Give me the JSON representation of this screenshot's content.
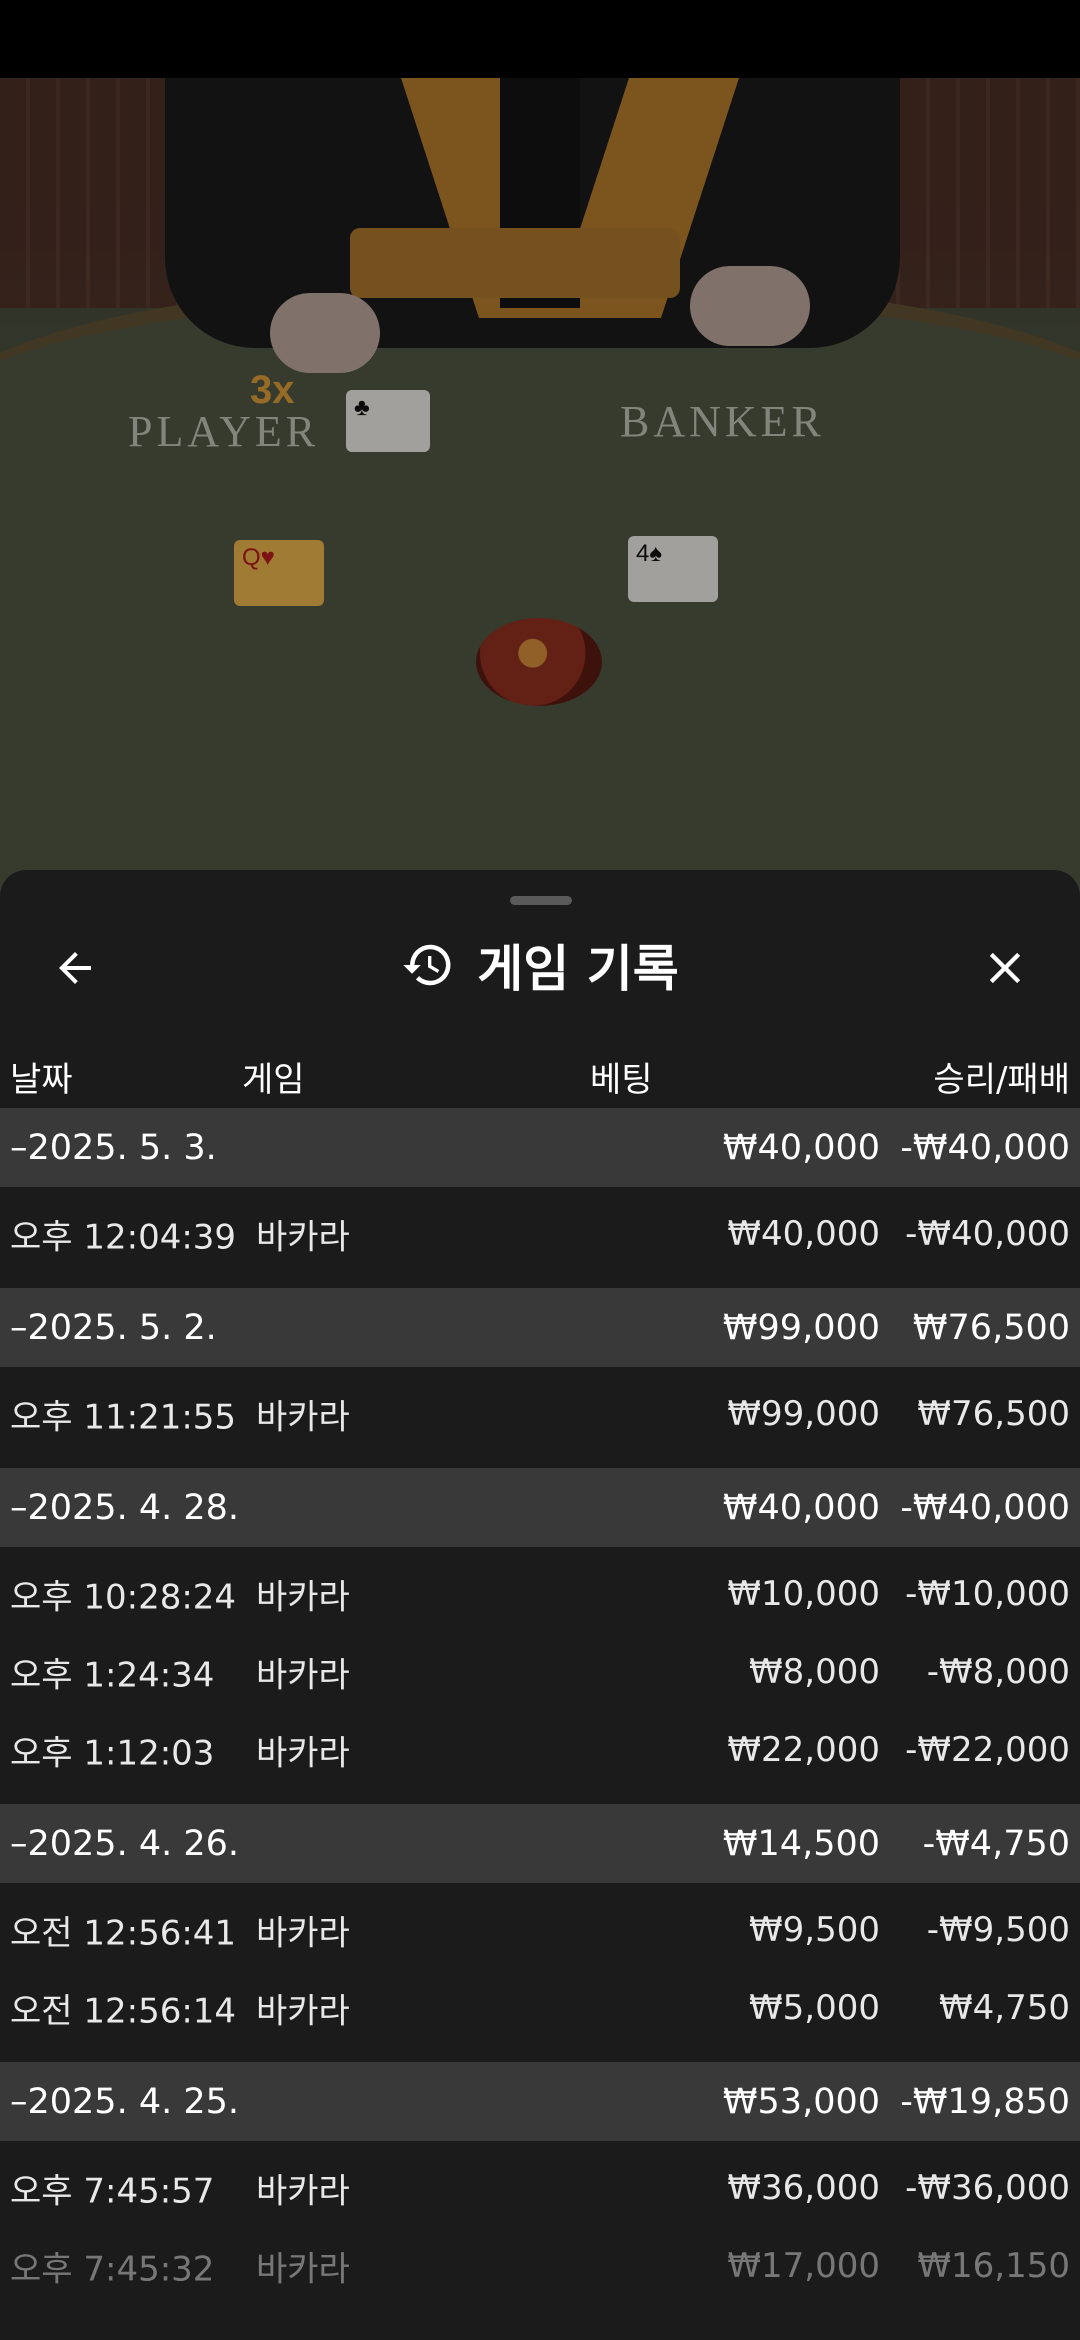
{
  "video": {
    "player_label": "PLAYER",
    "banker_label": "BANKER",
    "multiplier": "3x"
  },
  "header": {
    "title": "게임 기록",
    "back_icon": "arrow-left-icon",
    "history_icon": "history-clock-icon",
    "close_icon": "close-icon"
  },
  "columns": {
    "date": "날짜",
    "game": "게임",
    "bet": "베팅",
    "result": "승리/패배"
  },
  "groups": [
    {
      "date": "–2025. 5. 3.",
      "bet": "₩40,000",
      "result": "-₩40,000",
      "items": [
        {
          "time": "오후 12:04:39",
          "game": "바카라",
          "bet": "₩40,000",
          "result": "-₩40,000"
        }
      ]
    },
    {
      "date": "–2025. 5. 2.",
      "bet": "₩99,000",
      "result": "₩76,500",
      "items": [
        {
          "time": "오후 11:21:55",
          "game": "바카라",
          "bet": "₩99,000",
          "result": "₩76,500"
        }
      ]
    },
    {
      "date": "–2025. 4. 28.",
      "bet": "₩40,000",
      "result": "-₩40,000",
      "items": [
        {
          "time": "오후 10:28:24",
          "game": "바카라",
          "bet": "₩10,000",
          "result": "-₩10,000"
        },
        {
          "time": "오후 1:24:34",
          "game": "바카라",
          "bet": "₩8,000",
          "result": "-₩8,000"
        },
        {
          "time": "오후 1:12:03",
          "game": "바카라",
          "bet": "₩22,000",
          "result": "-₩22,000"
        }
      ]
    },
    {
      "date": "–2025. 4. 26.",
      "bet": "₩14,500",
      "result": "-₩4,750",
      "items": [
        {
          "time": "오전 12:56:41",
          "game": "바카라",
          "bet": "₩9,500",
          "result": "-₩9,500"
        },
        {
          "time": "오전 12:56:14",
          "game": "바카라",
          "bet": "₩5,000",
          "result": "₩4,750"
        }
      ]
    },
    {
      "date": "–2025. 4. 25.",
      "bet": "₩53,000",
      "result": "-₩19,850",
      "items": [
        {
          "time": "오후 7:45:57",
          "game": "바카라",
          "bet": "₩36,000",
          "result": "-₩36,000"
        },
        {
          "time": "오후 7:45:32",
          "game": "바카라",
          "bet": "₩17,000",
          "result": "₩16,150"
        }
      ]
    }
  ]
}
